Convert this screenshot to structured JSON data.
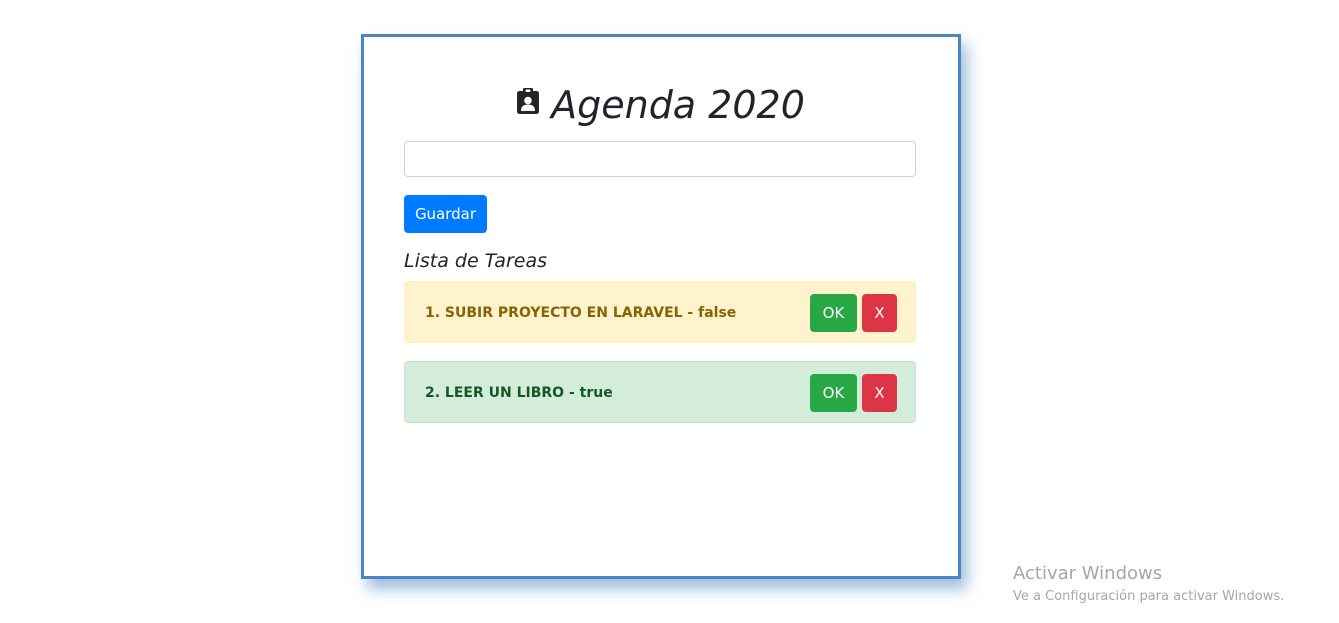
{
  "app": {
    "title": "Agenda 2020",
    "icon": "clipboard-user-icon"
  },
  "form": {
    "input_value": "",
    "input_placeholder": "",
    "save_label": "Guardar"
  },
  "list": {
    "title": "Lista de Tareas",
    "tasks": [
      {
        "text": "1. SUBIR PROYECTO EN LARAVEL - false",
        "status": "pending",
        "ok_label": "OK",
        "delete_label": "X"
      },
      {
        "text": "2. LEER UN LIBRO - true",
        "status": "done",
        "ok_label": "OK",
        "delete_label": "X"
      }
    ]
  },
  "watermark": {
    "title": "Activar Windows",
    "subtitle": "Ve a Configuración para activar Windows."
  },
  "colors": {
    "card_border": "#4a86c1",
    "primary": "#007bff",
    "success": "#28a745",
    "danger": "#dc3545",
    "warning_bg": "#fff3cd",
    "success_bg": "#d4edda"
  }
}
